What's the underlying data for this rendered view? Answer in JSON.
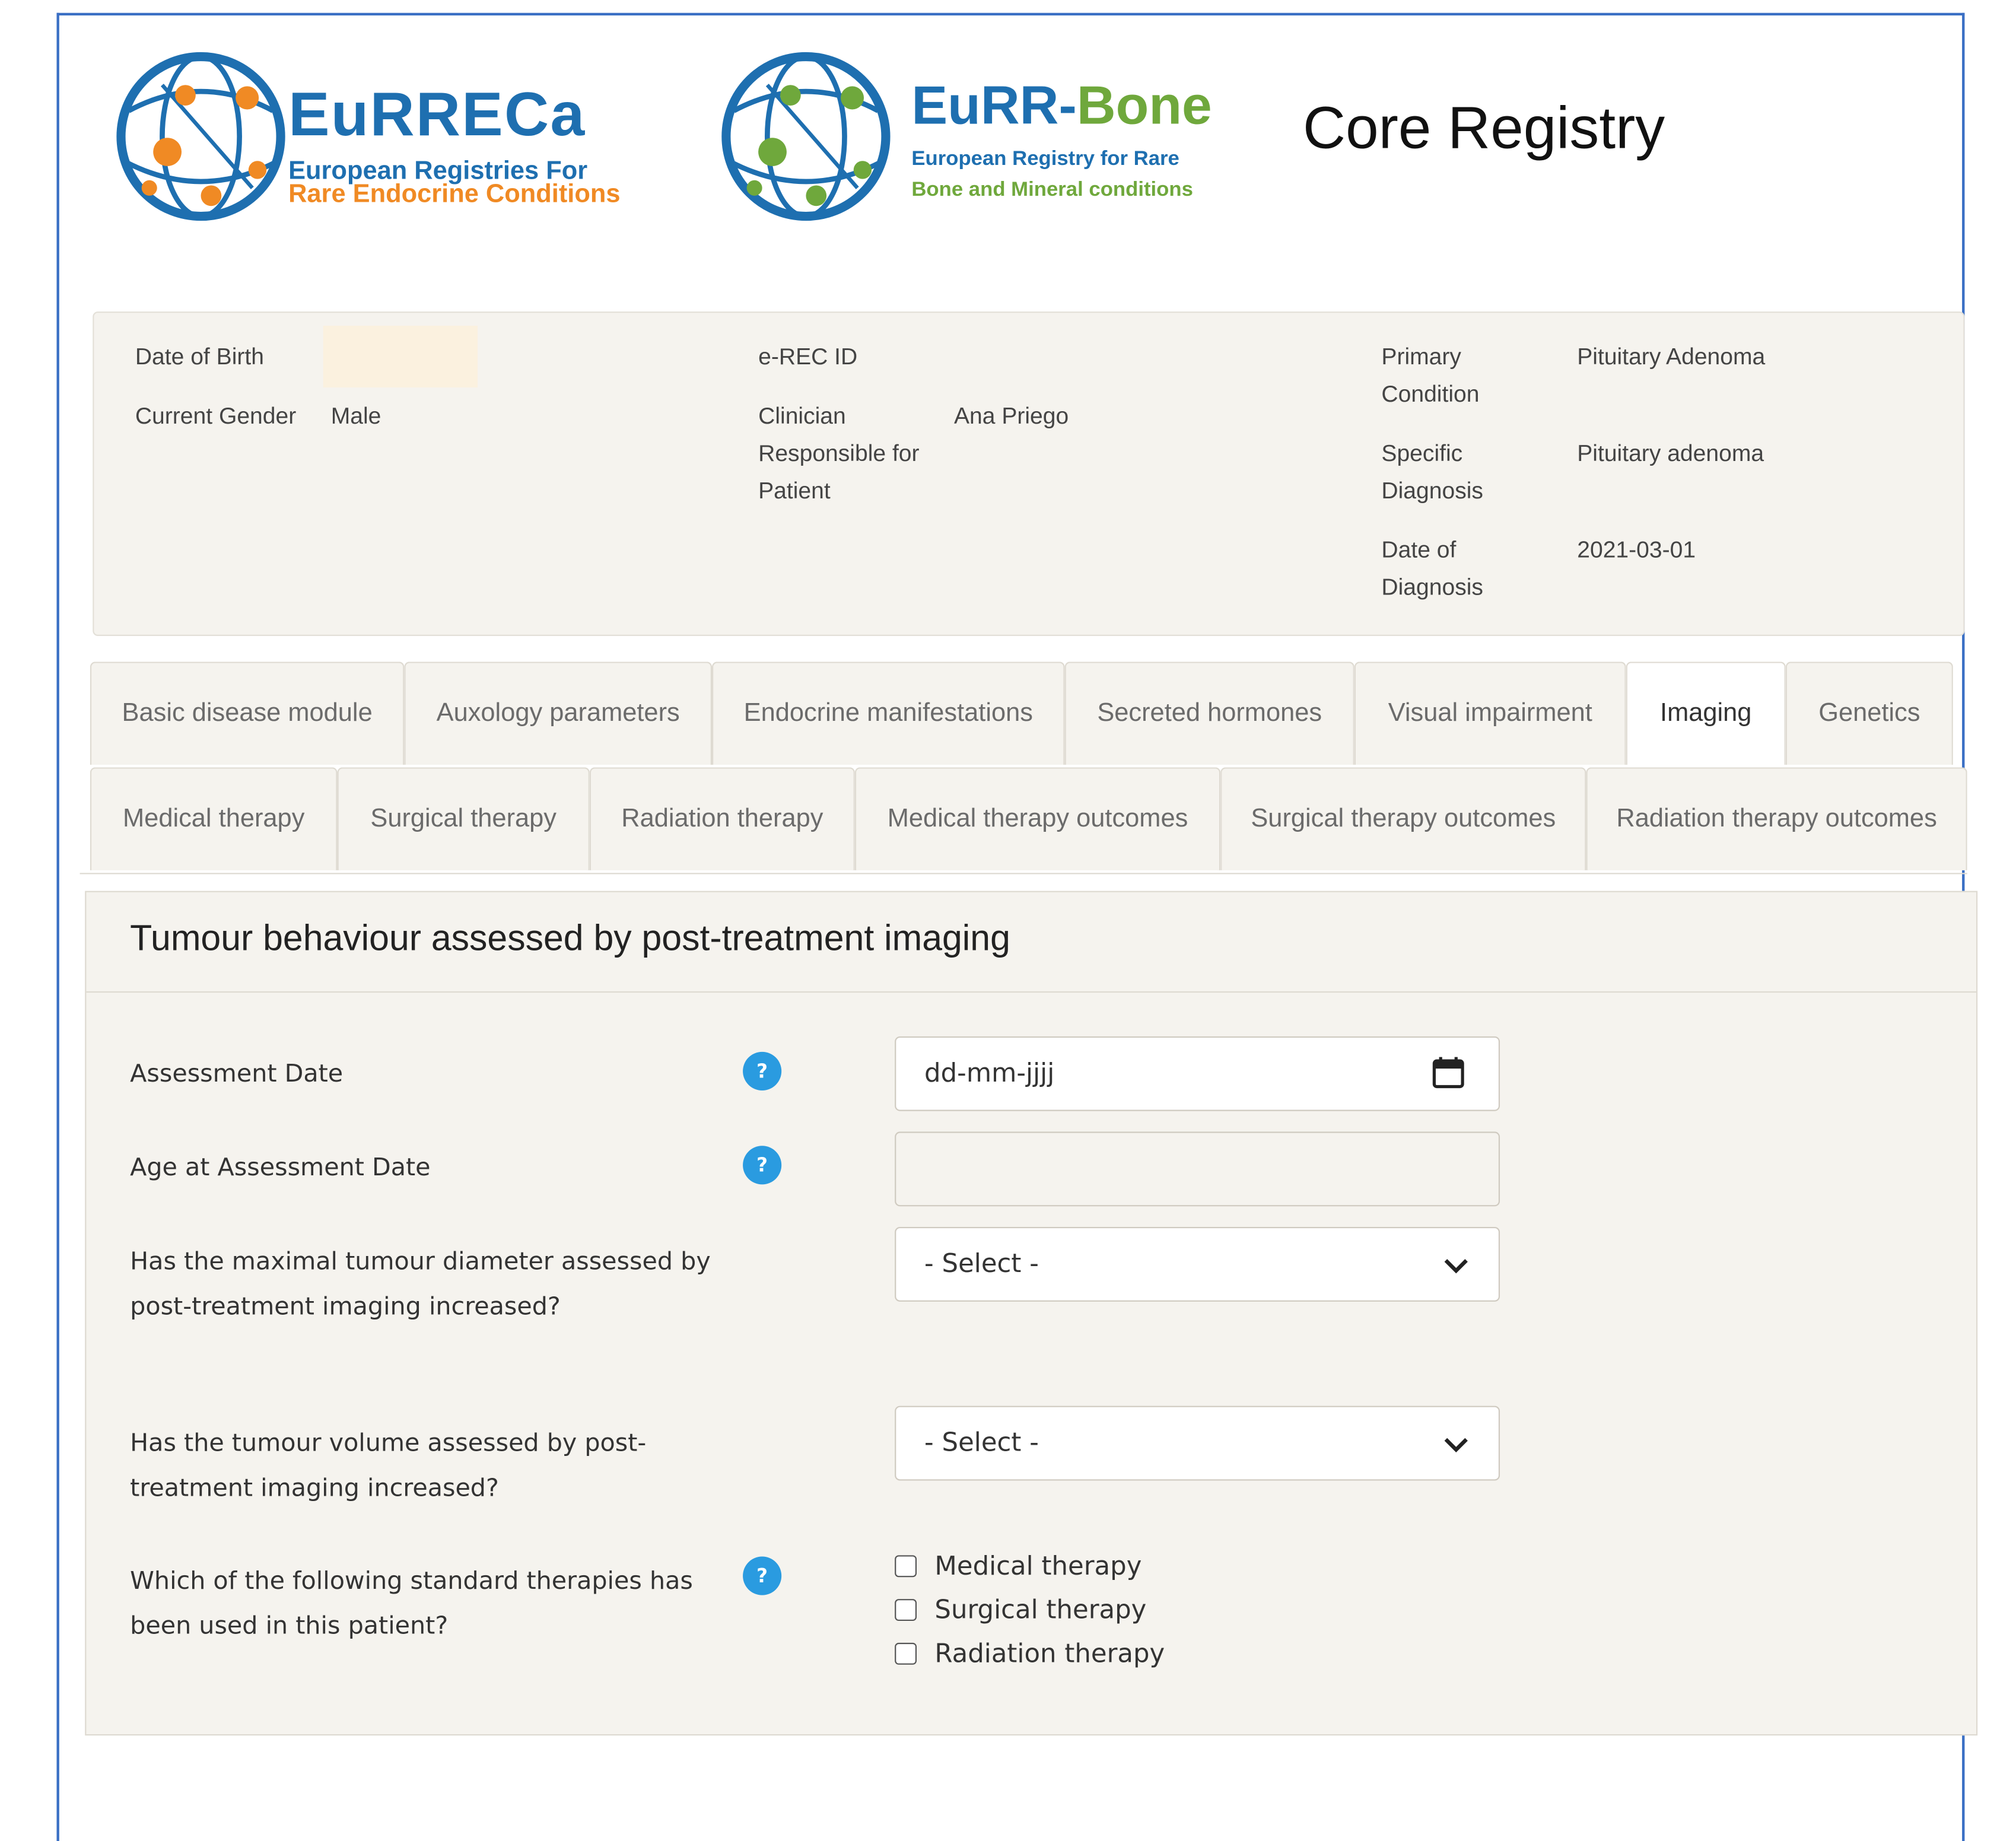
{
  "logos": {
    "eurreca": {
      "title": "EuRRECa",
      "sub1": "European Registries For",
      "sub2": "Rare Endocrine Conditions"
    },
    "bone": {
      "title_a": "EuRR-",
      "title_b": "Bone",
      "sub1": "European Registry for Rare",
      "sub2": "Bone and Mineral conditions"
    }
  },
  "page_title": "Core Registry",
  "summary": {
    "dob_label": "Date of Birth",
    "gender_label": "Current Gender",
    "gender_value": "Male",
    "erec_label": "e-REC ID",
    "clinician_label": "Clinician Responsible for Patient",
    "clinician_value": "Ana Priego",
    "primary_label": "Primary Condition",
    "primary_value": "Pituitary Adenoma",
    "specific_label": "Specific Diagnosis",
    "specific_value": "Pituitary adenoma",
    "date_diag_label": "Date of Diagnosis",
    "date_diag_value": "2021-03-01"
  },
  "tabs_row1": [
    "Basic disease module",
    "Auxology parameters",
    "Endocrine manifestations",
    "Secreted hormones",
    "Visual impairment",
    "Imaging",
    "Genetics"
  ],
  "tabs_row2": [
    "Medical therapy",
    "Surgical therapy",
    "Radiation therapy",
    "Medical therapy outcomes",
    "Surgical therapy outcomes",
    "Radiation therapy outcomes"
  ],
  "active_tab": "Imaging",
  "form": {
    "title": "Tumour behaviour assessed by post-treatment imaging",
    "assessment_date_label": "Assessment Date",
    "assessment_date_placeholder": "dd-mm-jjjj",
    "age_label": "Age at Assessment Date",
    "age_value": "",
    "diameter_label": "Has the maximal tumour diameter assessed by post-treatment imaging increased?",
    "diameter_value": "- Select -",
    "volume_label": "Has the tumour volume assessed by post-treatment imaging increased?",
    "volume_value": "- Select -",
    "therapies_label": "Which of the following standard therapies has been used in this patient?",
    "therapies": [
      "Medical therapy",
      "Surgical therapy",
      "Radiation therapy"
    ],
    "help_glyph": "?"
  },
  "colors": {
    "frame_border": "#3a6fc4",
    "panel_bg": "#f5f3ee",
    "help_icon": "#2a9be0",
    "logo_blue": "#1e6fb0",
    "logo_orange": "#f08a24",
    "logo_green": "#6fa83c"
  },
  "icons": [
    "globe-orange-icon",
    "globe-green-icon",
    "help-icon",
    "calendar-icon",
    "chevron-down-icon"
  ]
}
